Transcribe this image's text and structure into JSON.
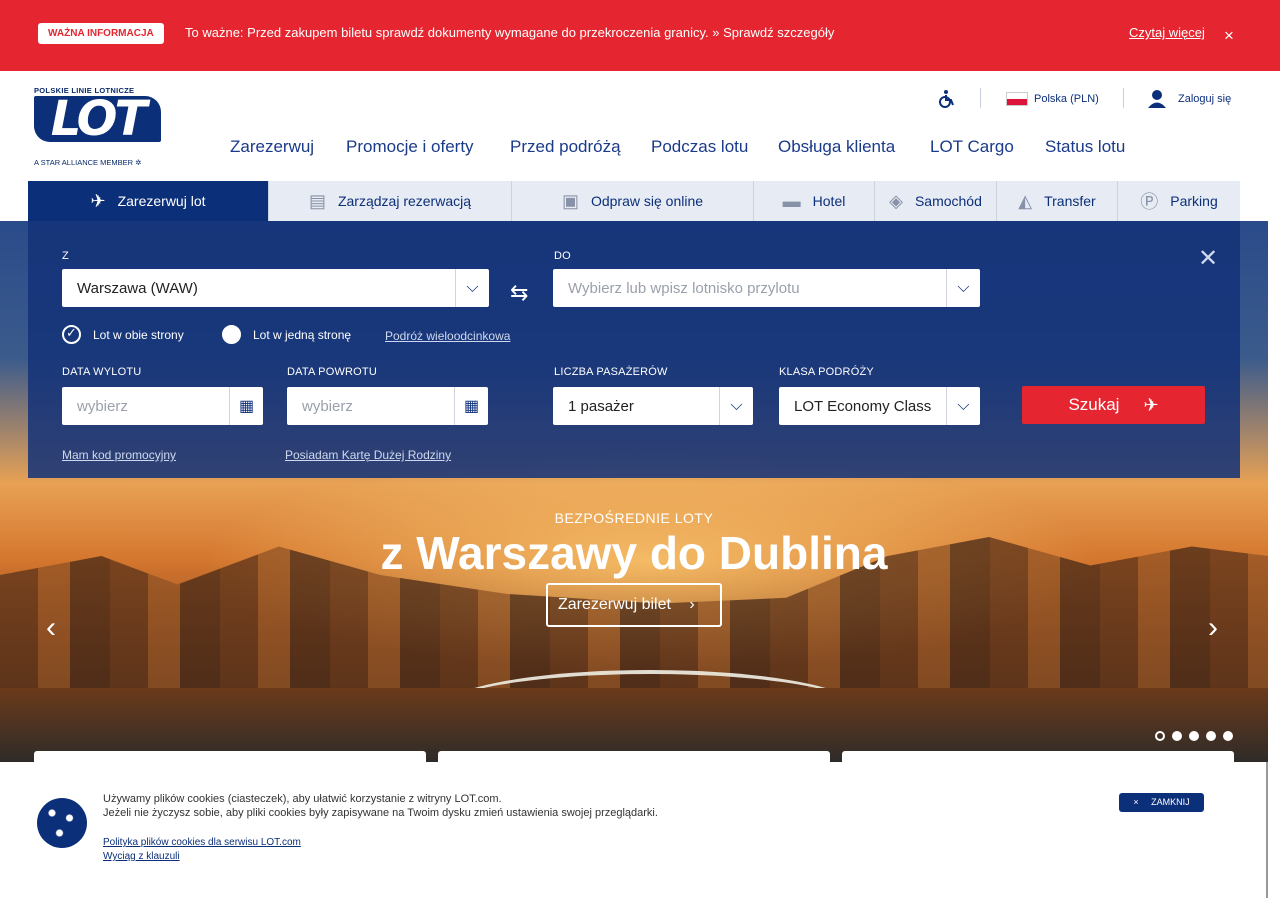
{
  "alert": {
    "badge": "WAŻNA INFORMACJA",
    "text": "To ważne: Przed zakupem biletu sprawdź dokumenty wymagane do przekroczenia granicy. » Sprawdź szczegóły",
    "more": "Czytaj więcej",
    "close": "×"
  },
  "logo": {
    "top": "POLSKIE LINIE LOTNICZE",
    "main": "LOT",
    "bottom": "A STAR ALLIANCE MEMBER ✲"
  },
  "utility": {
    "accessibility_icon": "wheelchair-icon",
    "country": "Polska (PLN)",
    "login": "Zaloguj się"
  },
  "nav": [
    "Zarezerwuj",
    "Promocje i oferty",
    "Przed podróżą",
    "Podczas lotu",
    "Obsługa klienta",
    "LOT Cargo",
    "Status lotu"
  ],
  "tabs": [
    {
      "label": "Zarezerwuj lot",
      "icon": "plane-icon"
    },
    {
      "label": "Zarządzaj rezerwacją",
      "icon": "id-card-icon"
    },
    {
      "label": "Odpraw się online",
      "icon": "ticket-icon"
    },
    {
      "label": "Hotel",
      "icon": "bed-icon"
    },
    {
      "label": "Samochód",
      "icon": "car-icon"
    },
    {
      "label": "Transfer",
      "icon": "taxi-icon"
    },
    {
      "label": "Parking",
      "icon": "parking-icon"
    }
  ],
  "booking": {
    "from_label": "Z",
    "from_value": "Warszawa (WAW)",
    "to_label": "DO",
    "to_placeholder": "Wybierz lub wpisz lotnisko przylotu",
    "round_trip": "Lot w obie strony",
    "one_way": "Lot w jedną stronę",
    "multi_city": "Podróż wieloodcinkowa",
    "depart_label": "DATA WYLOTU",
    "depart_placeholder": "wybierz",
    "return_label": "DATA POWROTU",
    "return_placeholder": "wybierz",
    "passengers_label": "LICZBA PASAŻERÓW",
    "passengers_value": "1 pasażer",
    "class_label": "KLASA PODRÓŻY",
    "class_value": "LOT Economy Class",
    "search": "Szukaj",
    "promo": "Mam kod promocyjny",
    "family_card": "Posiadam Kartę Dużej Rodziny",
    "close": "✕"
  },
  "hero": {
    "kicker": "BEZPOŚREDNIE LOTY",
    "title": "z Warszawy do Dublina",
    "cta": "Zarezerwuj bilet",
    "cta_arrow": "›",
    "prev": "‹",
    "next": "›",
    "slides_total": 5,
    "slide_active": 1
  },
  "cookie": {
    "line1": "Używamy plików cookies (ciasteczek), aby ułatwić korzystanie z witryny LOT.com.",
    "line2": "Jeżeli nie życzysz sobie, aby pliki cookies były zapisywane na Twoim dysku zmień ustawienia swojej przeglądarki.",
    "policy_link": "Polityka plików cookies dla serwisu LOT.com",
    "clause_link": "Wyciąg z klauzuli",
    "close": "ZAMKNIJ"
  }
}
